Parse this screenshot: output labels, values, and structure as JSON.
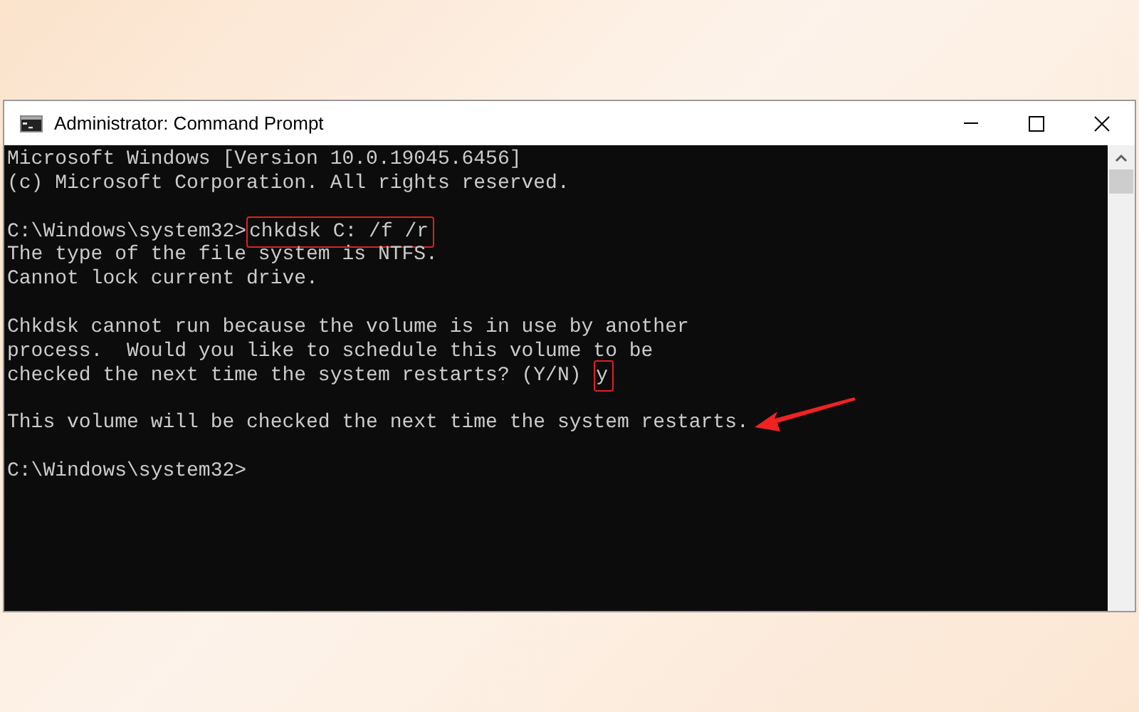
{
  "window": {
    "title": "Administrator: Command Prompt"
  },
  "console": {
    "lines": [
      {
        "kind": "text",
        "text": "Microsoft Windows [Version 10.0.19045.6456]"
      },
      {
        "kind": "text",
        "text": "(c) Microsoft Corporation. All rights reserved."
      },
      {
        "kind": "blank"
      },
      {
        "kind": "text",
        "text": "C:\\Windows\\system32>",
        "boxed": "chkdsk C: /f /r"
      },
      {
        "kind": "text",
        "text": "The type of the file system is NTFS."
      },
      {
        "kind": "text",
        "text": "Cannot lock current drive."
      },
      {
        "kind": "blank"
      },
      {
        "kind": "text",
        "text": "Chkdsk cannot run because the volume is in use by another"
      },
      {
        "kind": "text",
        "text": "process.  Would you like to schedule this volume to be"
      },
      {
        "kind": "text",
        "text": "checked the next time the system restarts? (Y/N) ",
        "boxed": "y"
      },
      {
        "kind": "blank"
      },
      {
        "kind": "text",
        "text": "This volume will be checked the next time the system restarts.",
        "arrow": true
      },
      {
        "kind": "blank"
      },
      {
        "kind": "text",
        "text": "C:\\Windows\\system32>"
      }
    ]
  }
}
